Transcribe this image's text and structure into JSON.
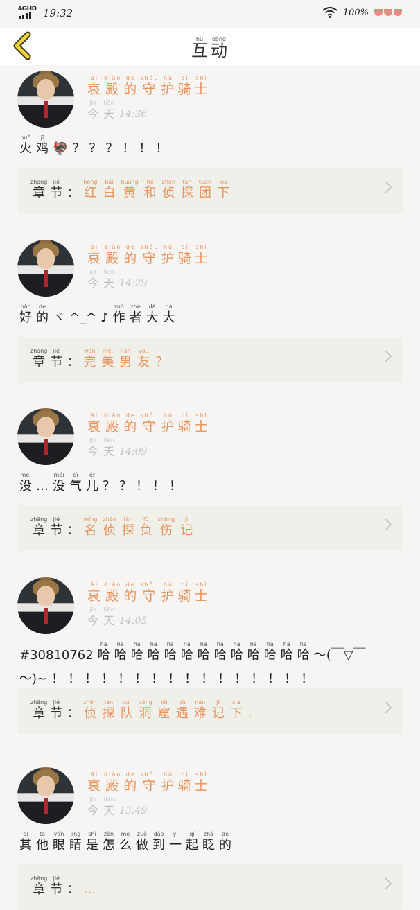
{
  "status_bar": {
    "network": "4GHD",
    "time": "19:32",
    "battery": "100%"
  },
  "header": {
    "title": [
      [
        "hù",
        "互"
      ],
      [
        "dòng",
        "动"
      ]
    ]
  },
  "items": [
    {
      "username": [
        [
          "āi",
          "哀"
        ],
        [
          "diàn",
          "殿"
        ],
        [
          "de",
          "的"
        ],
        [
          "shǒu",
          "守"
        ],
        [
          "hù",
          "护"
        ],
        [
          "qí",
          "骑"
        ],
        [
          "shì",
          "士"
        ]
      ],
      "day": [
        [
          "jīn",
          "今"
        ],
        [
          "tiān",
          "天"
        ]
      ],
      "clock": "14:36",
      "comment_lines": [
        [
          [
            "huǒ",
            "火"
          ],
          [
            "jī",
            "鸡"
          ],
          [
            "",
            "🦃"
          ],
          [
            "",
            "？"
          ],
          [
            "",
            "？"
          ],
          [
            "",
            "？"
          ],
          [
            "",
            "！"
          ],
          [
            "",
            "！"
          ],
          [
            "",
            "！"
          ]
        ]
      ],
      "chapter_label": [
        [
          "zhāng",
          "章"
        ],
        [
          "jié",
          "节"
        ]
      ],
      "chapter_title": [
        [
          "hóng",
          "红"
        ],
        [
          "bái",
          "白"
        ],
        [
          "huáng",
          "黄"
        ],
        [
          "hé",
          "和"
        ],
        [
          "zhēn",
          "侦"
        ],
        [
          "tàn",
          "探"
        ],
        [
          "tuán",
          "团"
        ],
        [
          "xià",
          "下"
        ]
      ]
    },
    {
      "username": [
        [
          "āi",
          "哀"
        ],
        [
          "diàn",
          "殿"
        ],
        [
          "de",
          "的"
        ],
        [
          "shǒu",
          "守"
        ],
        [
          "hù",
          "护"
        ],
        [
          "qí",
          "骑"
        ],
        [
          "shì",
          "士"
        ]
      ],
      "day": [
        [
          "jīn",
          "今"
        ],
        [
          "tiān",
          "天"
        ]
      ],
      "clock": "14:29",
      "comment_lines": [
        [
          [
            "hǎo",
            "好"
          ],
          [
            "de",
            "的"
          ],
          [
            "",
            "ヾ"
          ],
          [
            "",
            "^_^"
          ],
          [
            "",
            "♪"
          ],
          [
            "zuò",
            "作"
          ],
          [
            "zhě",
            "者"
          ],
          [
            "dà",
            "大"
          ],
          [
            "dà",
            "大"
          ]
        ]
      ],
      "chapter_label": [
        [
          "zhāng",
          "章"
        ],
        [
          "jié",
          "节"
        ]
      ],
      "chapter_title": [
        [
          "wán",
          "完"
        ],
        [
          "měi",
          "美"
        ],
        [
          "nán",
          "男"
        ],
        [
          "yǒu",
          "友"
        ],
        [
          "",
          "？"
        ]
      ]
    },
    {
      "username": [
        [
          "āi",
          "哀"
        ],
        [
          "diàn",
          "殿"
        ],
        [
          "de",
          "的"
        ],
        [
          "shǒu",
          "守"
        ],
        [
          "hù",
          "护"
        ],
        [
          "qí",
          "骑"
        ],
        [
          "shì",
          "士"
        ]
      ],
      "day": [
        [
          "jīn",
          "今"
        ],
        [
          "tiān",
          "天"
        ]
      ],
      "clock": "14:09",
      "comment_lines": [
        [
          [
            "méi",
            "没"
          ],
          [
            "",
            "…"
          ],
          [
            "méi",
            "没"
          ],
          [
            "qì",
            "气"
          ],
          [
            "ér",
            "儿"
          ],
          [
            "",
            "？"
          ],
          [
            "",
            "？"
          ],
          [
            "",
            "！"
          ],
          [
            "",
            "！"
          ],
          [
            "",
            "！"
          ]
        ]
      ],
      "chapter_label": [
        [
          "zhāng",
          "章"
        ],
        [
          "jié",
          "节"
        ]
      ],
      "chapter_title": [
        [
          "míng",
          "名"
        ],
        [
          "zhēn",
          "侦"
        ],
        [
          "tàn",
          "探"
        ],
        [
          "fù",
          "负"
        ],
        [
          "shāng",
          "伤"
        ],
        [
          "jì",
          "记"
        ]
      ]
    },
    {
      "username": [
        [
          "āi",
          "哀"
        ],
        [
          "diàn",
          "殿"
        ],
        [
          "de",
          "的"
        ],
        [
          "shǒu",
          "守"
        ],
        [
          "hù",
          "护"
        ],
        [
          "qí",
          "骑"
        ],
        [
          "shì",
          "士"
        ]
      ],
      "day": [
        [
          "jīn",
          "今"
        ],
        [
          "tiān",
          "天"
        ]
      ],
      "clock": "14:05",
      "comment_lines": [
        [
          [
            "",
            "#30810762"
          ],
          [
            "hā",
            "哈"
          ],
          [
            "hā",
            "哈"
          ],
          [
            "hā",
            "哈"
          ],
          [
            "hā",
            "哈"
          ],
          [
            "hā",
            "哈"
          ],
          [
            "hā",
            "哈"
          ],
          [
            "hā",
            "哈"
          ],
          [
            "hā",
            "哈"
          ],
          [
            "hā",
            "哈"
          ],
          [
            "hā",
            "哈"
          ],
          [
            "hā",
            "哈"
          ],
          [
            "hā",
            "哈"
          ],
          [
            "hā",
            "哈"
          ],
          [
            "",
            "～(￣▽￣"
          ]
        ],
        [
          [
            "",
            "～)~"
          ],
          [
            "",
            "！"
          ],
          [
            "",
            "！"
          ],
          [
            "",
            "！"
          ],
          [
            "",
            "！"
          ],
          [
            "",
            "！"
          ],
          [
            "",
            "！"
          ],
          [
            "",
            "！"
          ],
          [
            "",
            "！"
          ],
          [
            "",
            "！"
          ],
          [
            "",
            "！"
          ],
          [
            "",
            "！"
          ],
          [
            "",
            "！"
          ],
          [
            "",
            "！"
          ],
          [
            "",
            "！"
          ],
          [
            "",
            "！"
          ],
          [
            "",
            "！"
          ]
        ]
      ],
      "chapter_label": [
        [
          "zhāng",
          "章"
        ],
        [
          "jié",
          "节"
        ]
      ],
      "chapter_title": [
        [
          "zhēn",
          "侦"
        ],
        [
          "tàn",
          "探"
        ],
        [
          "duì",
          "队"
        ],
        [
          "dòng",
          "洞"
        ],
        [
          "kū",
          "窟"
        ],
        [
          "yù",
          "遇"
        ],
        [
          "nán",
          "难"
        ],
        [
          "jì",
          "记"
        ],
        [
          "xià",
          "下"
        ],
        [
          "",
          "."
        ]
      ]
    },
    {
      "username": [
        [
          "āi",
          "哀"
        ],
        [
          "diàn",
          "殿"
        ],
        [
          "de",
          "的"
        ],
        [
          "shǒu",
          "守"
        ],
        [
          "hù",
          "护"
        ],
        [
          "qí",
          "骑"
        ],
        [
          "shì",
          "士"
        ]
      ],
      "day": [
        [
          "jīn",
          "今"
        ],
        [
          "tiān",
          "天"
        ]
      ],
      "clock": "13:49",
      "comment_lines": [
        [
          [
            "qí",
            "其"
          ],
          [
            "tā",
            "他"
          ],
          [
            "yǎn",
            "眼"
          ],
          [
            "jīng",
            "睛"
          ],
          [
            "shì",
            "是"
          ],
          [
            "zěn",
            "怎"
          ],
          [
            "me",
            "么"
          ],
          [
            "zuò",
            "做"
          ],
          [
            "dào",
            "到"
          ],
          [
            "yī",
            "一"
          ],
          [
            "qǐ",
            "起"
          ],
          [
            "zhǎ",
            "眨"
          ],
          [
            "de",
            "的"
          ]
        ]
      ],
      "chapter_label": [
        [
          "zhāng",
          "章"
        ],
        [
          "jié",
          "节"
        ]
      ],
      "chapter_title": [
        [
          "",
          "…"
        ]
      ]
    }
  ]
}
